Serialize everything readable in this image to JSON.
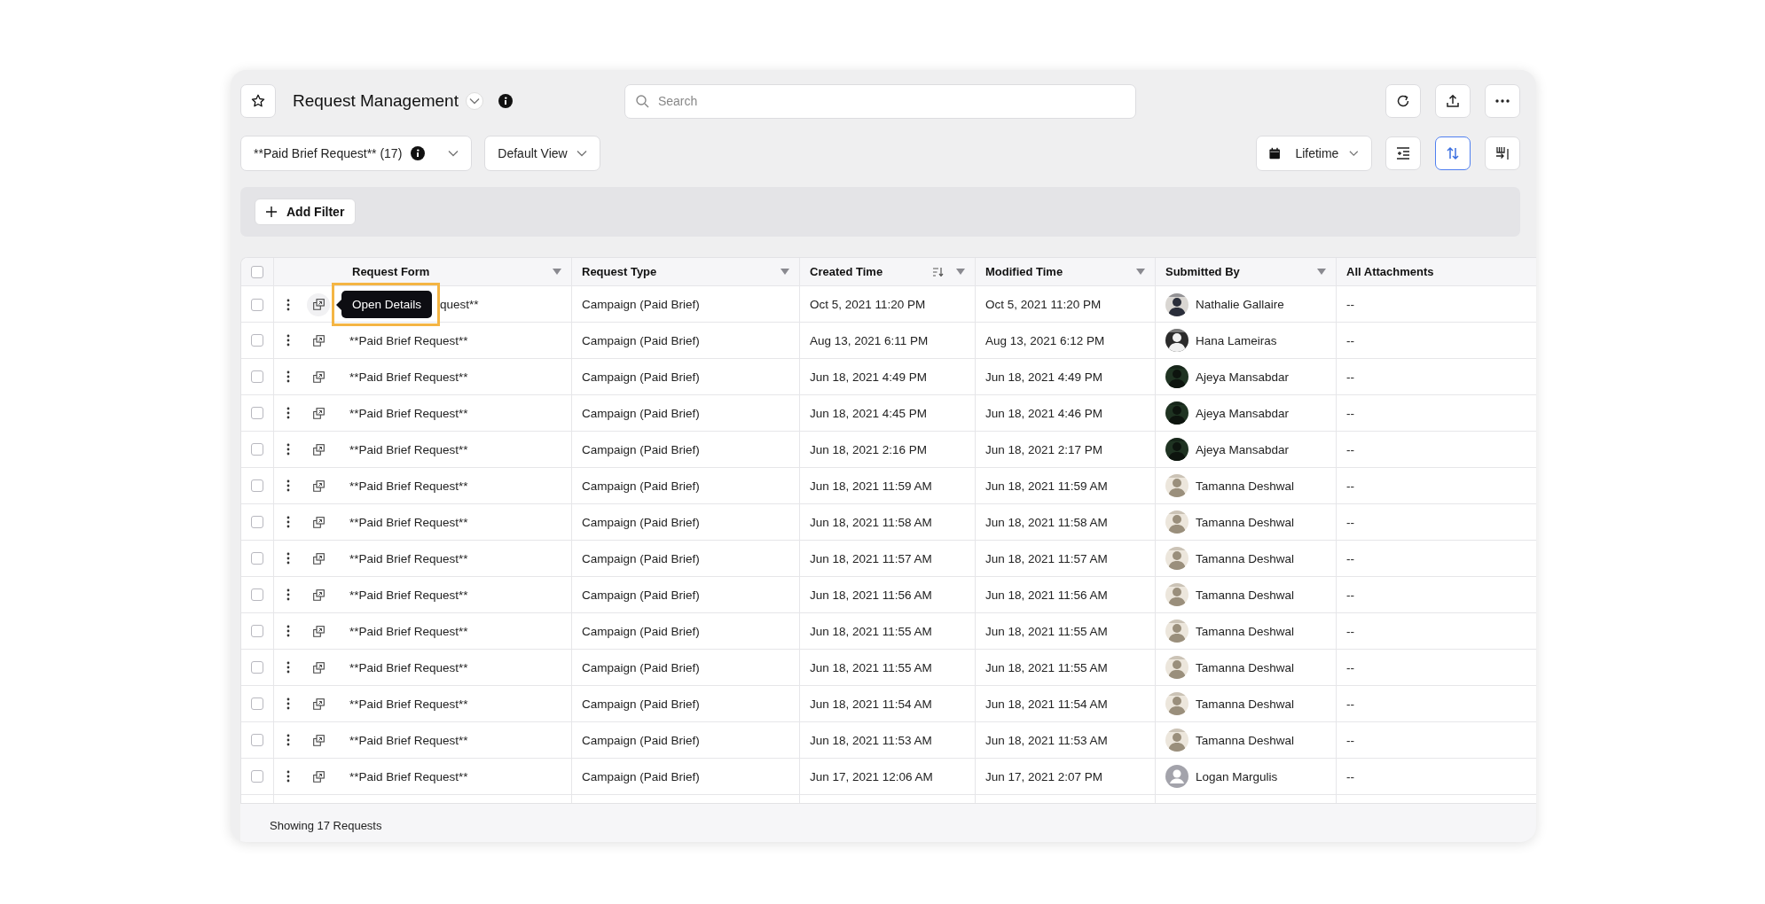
{
  "header": {
    "title": "Request Management",
    "search": {
      "placeholder": "Search"
    },
    "actions": [
      {
        "kind": "refresh"
      },
      {
        "kind": "export"
      },
      {
        "kind": "more"
      }
    ]
  },
  "toolbar": {
    "form_dropdown": "**Paid Brief Request** (17)",
    "view_dropdown": "Default View",
    "date_range": "Lifetime",
    "view_buttons": [
      {
        "kind": "indent",
        "selected": false
      },
      {
        "kind": "sort",
        "selected": true
      },
      {
        "kind": "columns",
        "selected": false
      }
    ]
  },
  "filter_bar": {
    "add_filter": "Add Filter"
  },
  "table": {
    "select_all": {
      "checked": false
    },
    "columns": [
      {
        "label": "Request Form",
        "filter": true,
        "sorted": false
      },
      {
        "label": "Request Type",
        "filter": true,
        "sorted": false
      },
      {
        "label": "Created Time",
        "filter": true,
        "sorted": true
      },
      {
        "label": "Modified Time",
        "filter": true,
        "sorted": false
      },
      {
        "label": "Submitted By",
        "filter": true,
        "sorted": false
      },
      {
        "label": "All Attachments",
        "filter": false,
        "sorted": false
      }
    ],
    "rows": [
      {
        "checked": false,
        "tooltip": "Open Details",
        "request_form": "quest**",
        "request_type": "Campaign (Paid Brief)",
        "created": "Oct 5, 2021 11:20 PM",
        "modified": "Oct 5, 2021 11:20 PM",
        "submitted_by": "Nathalie Gallaire",
        "attachments": "--"
      },
      {
        "checked": false,
        "request_form": "**Paid Brief Request**",
        "request_type": "Campaign (Paid Brief)",
        "created": "Aug 13, 2021 6:11 PM",
        "modified": "Aug 13, 2021 6:12 PM",
        "submitted_by": "Hana Lameiras",
        "attachments": "--"
      },
      {
        "checked": false,
        "request_form": "**Paid Brief Request**",
        "request_type": "Campaign (Paid Brief)",
        "created": "Jun 18, 2021 4:49 PM",
        "modified": "Jun 18, 2021 4:49 PM",
        "submitted_by": "Ajeya Mansabdar",
        "attachments": "--"
      },
      {
        "checked": false,
        "request_form": "**Paid Brief Request**",
        "request_type": "Campaign (Paid Brief)",
        "created": "Jun 18, 2021 4:45 PM",
        "modified": "Jun 18, 2021 4:46 PM",
        "submitted_by": "Ajeya Mansabdar",
        "attachments": "--"
      },
      {
        "checked": false,
        "request_form": "**Paid Brief Request**",
        "request_type": "Campaign (Paid Brief)",
        "created": "Jun 18, 2021 2:16 PM",
        "modified": "Jun 18, 2021 2:17 PM",
        "submitted_by": "Ajeya Mansabdar",
        "attachments": "--"
      },
      {
        "checked": false,
        "request_form": "**Paid Brief Request**",
        "request_type": "Campaign (Paid Brief)",
        "created": "Jun 18, 2021 11:59 AM",
        "modified": "Jun 18, 2021 11:59 AM",
        "submitted_by": "Tamanna Deshwal",
        "attachments": "--"
      },
      {
        "checked": false,
        "request_form": "**Paid Brief Request**",
        "request_type": "Campaign (Paid Brief)",
        "created": "Jun 18, 2021 11:58 AM",
        "modified": "Jun 18, 2021 11:58 AM",
        "submitted_by": "Tamanna Deshwal",
        "attachments": "--"
      },
      {
        "checked": false,
        "request_form": "**Paid Brief Request**",
        "request_type": "Campaign (Paid Brief)",
        "created": "Jun 18, 2021 11:57 AM",
        "modified": "Jun 18, 2021 11:57 AM",
        "submitted_by": "Tamanna Deshwal",
        "attachments": "--"
      },
      {
        "checked": false,
        "request_form": "**Paid Brief Request**",
        "request_type": "Campaign (Paid Brief)",
        "created": "Jun 18, 2021 11:56 AM",
        "modified": "Jun 18, 2021 11:56 AM",
        "submitted_by": "Tamanna Deshwal",
        "attachments": "--"
      },
      {
        "checked": false,
        "request_form": "**Paid Brief Request**",
        "request_type": "Campaign (Paid Brief)",
        "created": "Jun 18, 2021 11:55 AM",
        "modified": "Jun 18, 2021 11:55 AM",
        "submitted_by": "Tamanna Deshwal",
        "attachments": "--"
      },
      {
        "checked": false,
        "request_form": "**Paid Brief Request**",
        "request_type": "Campaign (Paid Brief)",
        "created": "Jun 18, 2021 11:55 AM",
        "modified": "Jun 18, 2021 11:55 AM",
        "submitted_by": "Tamanna Deshwal",
        "attachments": "--"
      },
      {
        "checked": false,
        "request_form": "**Paid Brief Request**",
        "request_type": "Campaign (Paid Brief)",
        "created": "Jun 18, 2021 11:54 AM",
        "modified": "Jun 18, 2021 11:54 AM",
        "submitted_by": "Tamanna Deshwal",
        "attachments": "--"
      },
      {
        "checked": false,
        "request_form": "**Paid Brief Request**",
        "request_type": "Campaign (Paid Brief)",
        "created": "Jun 18, 2021 11:53 AM",
        "modified": "Jun 18, 2021 11:53 AM",
        "submitted_by": "Tamanna Deshwal",
        "attachments": "--"
      },
      {
        "checked": false,
        "request_form": "**Paid Brief Request**",
        "request_type": "Campaign (Paid Brief)",
        "created": "Jun 17, 2021 12:06 AM",
        "modified": "Jun 17, 2021 2:07 PM",
        "submitted_by": "Logan Margulis",
        "avatar": {
          "kind": "placeholder"
        },
        "attachments": "--"
      }
    ]
  },
  "footer": {
    "summary": "Showing 17 Requests"
  }
}
